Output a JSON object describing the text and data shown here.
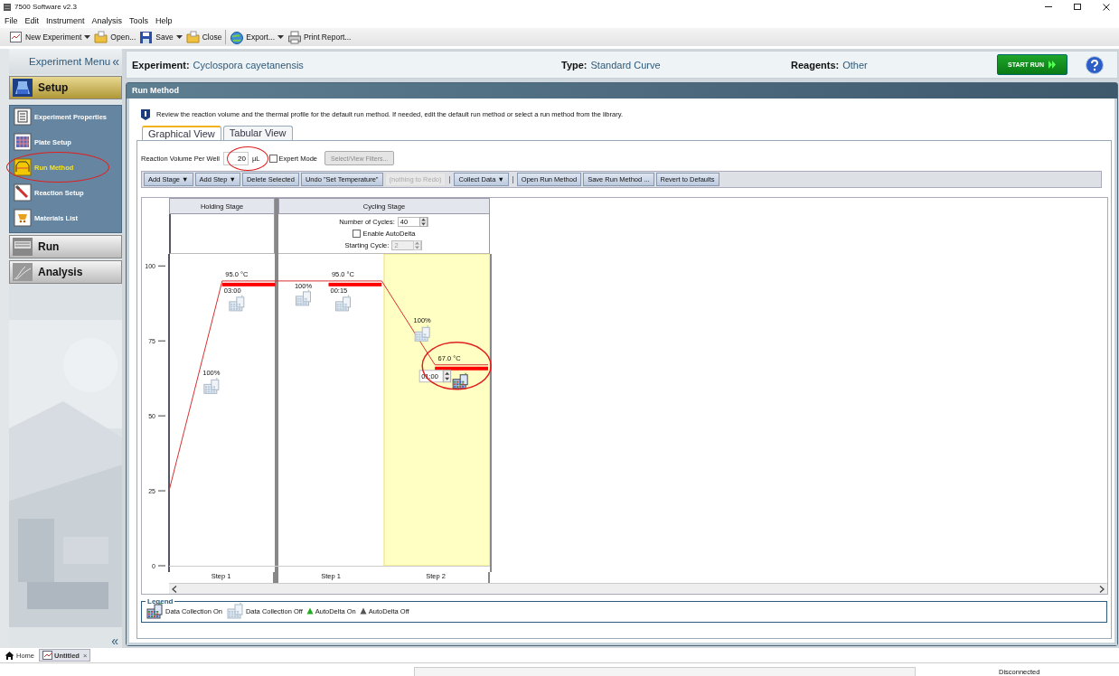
{
  "window": {
    "title": "7500 Software v2.3"
  },
  "menu": [
    "File",
    "Edit",
    "Instrument",
    "Analysis",
    "Tools",
    "Help"
  ],
  "toolbar": [
    {
      "label": "New Experiment",
      "dropdown": true
    },
    {
      "label": "Open...",
      "dropdown": false
    },
    {
      "label": "Save",
      "dropdown": true
    },
    {
      "label": "Close",
      "dropdown": false
    },
    {
      "label": "Export...",
      "dropdown": true
    },
    {
      "label": "Print Report...",
      "dropdown": false
    }
  ],
  "sidebar": {
    "title": "Experiment Menu",
    "collapse": "«",
    "footer": "«",
    "sections": [
      {
        "label": "Setup",
        "selected": true,
        "items": [
          {
            "label": "Experiment Properties",
            "selected": false,
            "circled": false
          },
          {
            "label": "Plate Setup",
            "selected": false,
            "circled": false
          },
          {
            "label": "Run Method",
            "selected": true,
            "circled": true
          },
          {
            "label": "Reaction Setup",
            "selected": false,
            "circled": false
          },
          {
            "label": "Materials List",
            "selected": false,
            "circled": false
          }
        ]
      },
      {
        "label": "Run",
        "selected": false
      },
      {
        "label": "Analysis",
        "selected": false
      }
    ]
  },
  "experiment": {
    "name_label": "Experiment:",
    "name": "Cyclospora cayetanensis",
    "type_label": "Type:",
    "type": "Standard Curve",
    "reagents_label": "Reagents:",
    "reagents": "Other",
    "start_button": "START RUN"
  },
  "panel": {
    "title": "Run Method",
    "info": "Review the reaction volume and the thermal profile for the default run method. If needed, edit the default run method or select a run method from the library.",
    "tabs": [
      {
        "label": "Graphical View",
        "selected": true
      },
      {
        "label": "Tabular View",
        "selected": false
      }
    ],
    "volume": {
      "label": "Reaction Volume Per Well",
      "value": "20",
      "unit": "µL",
      "circled": true
    },
    "expert_mode": {
      "label": "Expert Mode",
      "checked": false
    },
    "filters_button": {
      "label": "Select/View Filters...",
      "disabled": true
    },
    "actions": [
      {
        "label": "Add Stage ▼",
        "disabled": false
      },
      {
        "label": "Add Step ▼",
        "disabled": false
      },
      {
        "label": "Delete Selected",
        "disabled": false
      },
      {
        "label": "Undo \"Set Temperature\"",
        "disabled": false
      },
      {
        "label": "(nothing to Redo)",
        "disabled": true
      },
      {
        "label": "Collect Data ▼",
        "disabled": false
      },
      {
        "label": "Open Run Method",
        "disabled": false
      },
      {
        "label": "Save Run Method ...",
        "disabled": false
      },
      {
        "label": "Revert to Defaults",
        "disabled": false
      }
    ]
  },
  "profile": {
    "stages": [
      {
        "title": "Holding Stage",
        "steps": [
          {
            "label": "Step 1",
            "temperature": "95.0 °C",
            "time": "03:00",
            "ramp_rate": "100%",
            "ramp_collection": false,
            "hold_collection": false,
            "selected": false,
            "editing": false,
            "circled": false
          }
        ]
      },
      {
        "title": "Cycling Stage",
        "cycles_label": "Number of Cycles:",
        "cycles": "40",
        "autodelta": {
          "label": "Enable AutoDelta",
          "checked": false
        },
        "starting_cycle_label": "Starting Cycle:",
        "starting_cycle": "2",
        "starting_cycle_disabled": true,
        "steps": [
          {
            "label": "Step 1",
            "temperature": "95.0 °C",
            "time": "00:15",
            "ramp_rate": "100%",
            "ramp_collection": false,
            "hold_collection": false,
            "selected": false,
            "editing": false,
            "circled": false
          },
          {
            "label": "Step 2",
            "temperature": "67.0 °C",
            "time": "01:00",
            "ramp_rate": "100%",
            "ramp_collection": false,
            "hold_collection": true,
            "selected": true,
            "editing": true,
            "circled": true
          }
        ]
      }
    ],
    "chart_data": {
      "type": "line",
      "ylim": [
        0,
        104
      ],
      "yticks": [
        0,
        25,
        50,
        75,
        100
      ],
      "series": [
        {
          "color": "#d83030",
          "values": [
            25,
            95,
            95,
            95,
            95,
            67,
            67
          ]
        }
      ]
    }
  },
  "legend": {
    "title": "Legend",
    "items": [
      {
        "kind": "collect_on",
        "label": "Data Collection On"
      },
      {
        "kind": "collect_off",
        "label": "Data Collection Off"
      },
      {
        "kind": "autodelta_on",
        "label": "AutoDelta On"
      },
      {
        "kind": "autodelta_off",
        "label": "AutoDelta Off"
      }
    ]
  },
  "bottom_tabs": [
    {
      "label": "Home",
      "selected": false
    },
    {
      "label": "Untitled",
      "selected": true,
      "close": "×"
    }
  ],
  "status_bar": {
    "progress": {
      "level": 0
    },
    "connection": "Disconnected"
  }
}
